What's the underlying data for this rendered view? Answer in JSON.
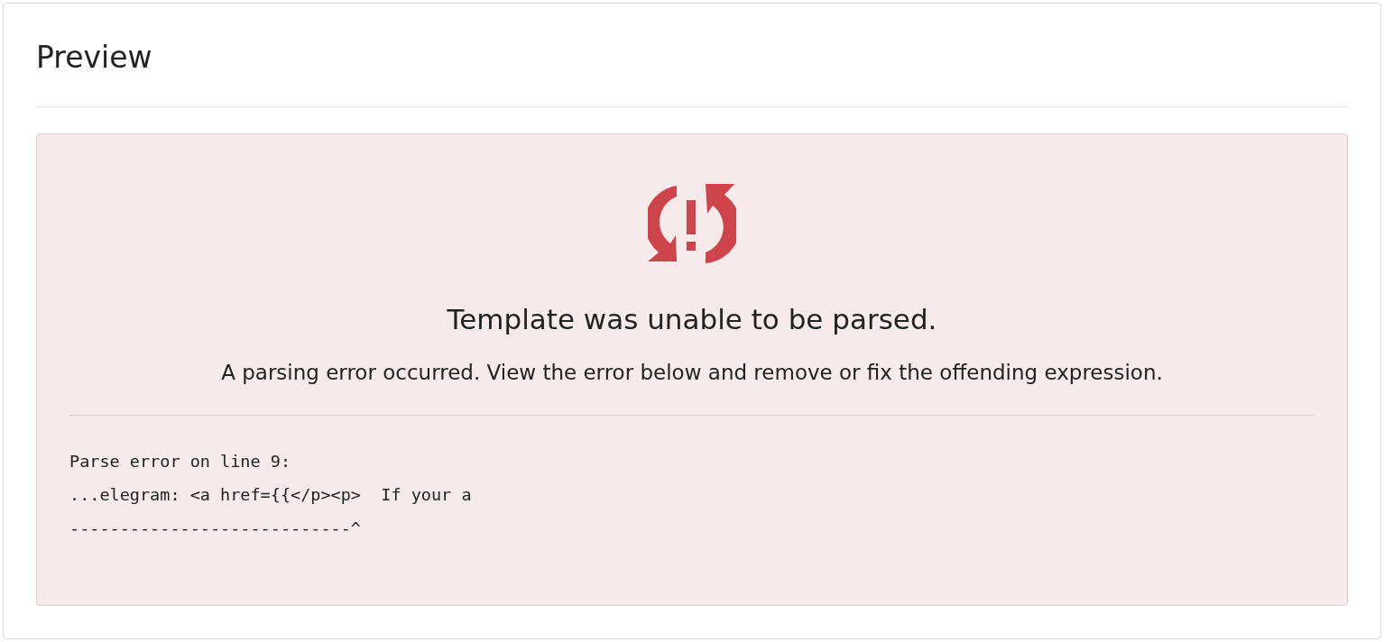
{
  "panel": {
    "title": "Preview"
  },
  "error": {
    "heading": "Template was unable to be parsed.",
    "message": "A parsing error occurred. View the error below and remove or fix the offending expression.",
    "details": [
      "Parse error on line 9:",
      "...elegram: <a href={{</p><p>  If your a",
      "----------------------------^"
    ]
  }
}
